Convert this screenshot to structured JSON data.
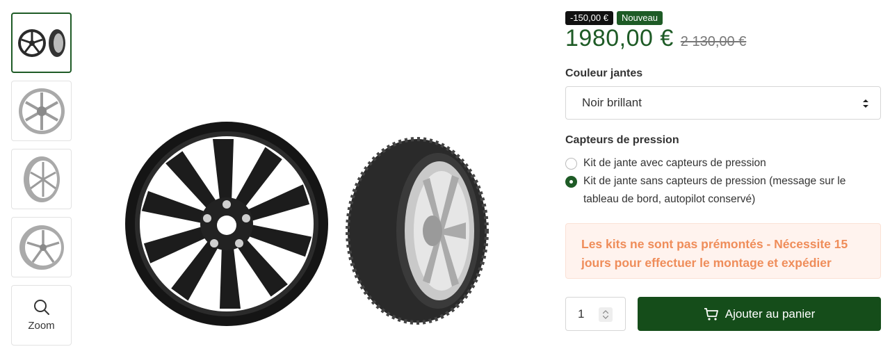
{
  "gallery": {
    "thumbnails": [
      {
        "name": "wheel-and-tire-thumb",
        "selected": true
      },
      {
        "name": "silver-wheel-front-thumb",
        "selected": false
      },
      {
        "name": "silver-wheel-angle-thumb",
        "selected": false
      },
      {
        "name": "silver-wheel-side-thumb",
        "selected": false
      }
    ],
    "zoom_label": "Zoom",
    "zoom_icon": "search-icon"
  },
  "product": {
    "discount_badge": "-150,00 €",
    "new_badge": "Nouveau",
    "price": "1980,00 €",
    "old_price": "2 130,00 €"
  },
  "options": {
    "color_label": "Couleur jantes",
    "color_value": "Noir brillant",
    "sensors_label": "Capteurs de pression",
    "sensors": [
      {
        "label": "Kit de jante avec capteurs de pression",
        "checked": false
      },
      {
        "label": "Kit de jante sans capteurs de pression (message sur le tableau de bord, autopilot conservé)",
        "checked": true
      }
    ]
  },
  "notice": "Les kits ne sont pas prémontés - Nécessite 15 jours pour effectuer le montage et expédier",
  "cart": {
    "quantity": "1",
    "add_label": "Ajouter au panier",
    "cart_icon": "cart-icon"
  },
  "colors": {
    "brand_green": "#1e5b26",
    "button_green": "#154d1a",
    "notice_text": "#ef8d5a",
    "notice_bg": "#fff3ee"
  }
}
